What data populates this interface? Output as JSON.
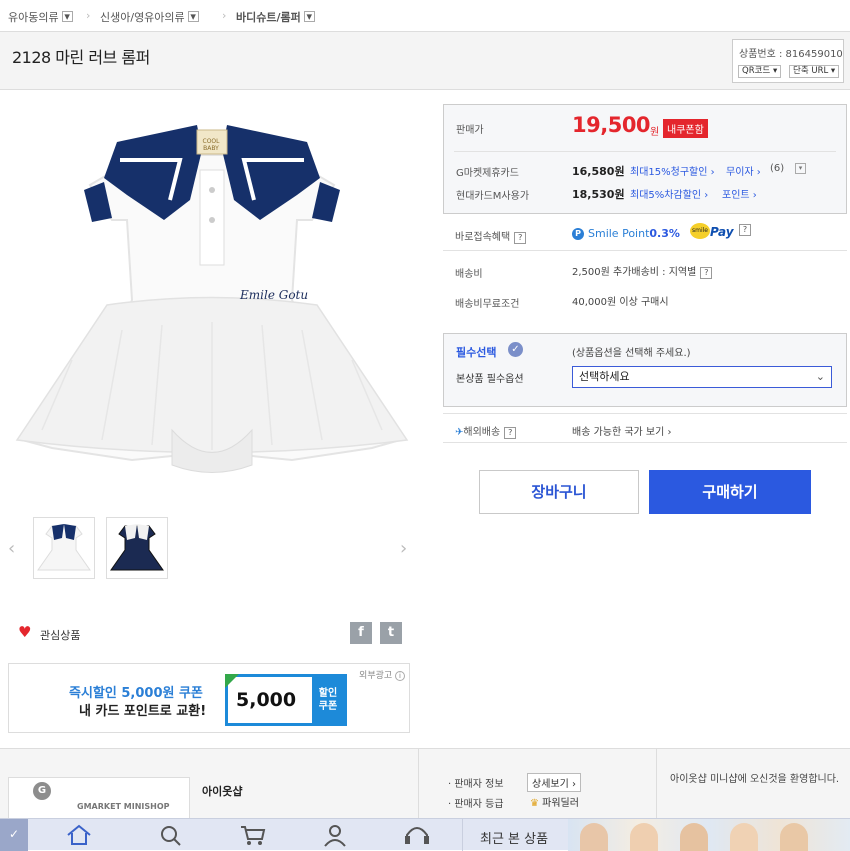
{
  "breadcrumb": {
    "level1": "유아동의류",
    "level2": "신생아/영유아의류",
    "level3": "바디슈트/롬퍼"
  },
  "product": {
    "title": "2128 마린 러브 롬퍼",
    "number_label": "상품번호 : 816459010",
    "qr_button": "QR코드",
    "short_url_button": "단축 URL"
  },
  "images": {
    "collar_tag": "COOL BABY",
    "embroidery": "Emile Gotu",
    "thumbs": [
      "white-romper",
      "navy-romper"
    ]
  },
  "price": {
    "label": "판매가",
    "value": "19,500",
    "unit": "원",
    "coupon_badge": "내쿠폰함",
    "card1_label": "G마켓제휴카드",
    "card1_price": "16,580원",
    "card1_discount": "최대15%청구할인",
    "card1_extra": "무이자",
    "card1_count": "(6)",
    "card2_label": "현대카드M사용가",
    "card2_price": "18,530원",
    "card2_discount": "최대5%차감할인",
    "card2_extra": "포인트"
  },
  "benefit": {
    "label": "바로접속혜택",
    "smile_point": "Smile Point",
    "rate": "0.3%",
    "smile_logo": "smile",
    "pay": "Pay"
  },
  "shipping": {
    "fee_label": "배송비",
    "fee_value": "2,500원 추가배송비 : 지역별",
    "free_label": "배송비무료조건",
    "free_value": "40,000원 이상 구매시"
  },
  "options": {
    "required_label": "필수선택",
    "hint": "(상품옵션을 선택해 주세요.)",
    "option_label": "본상품 필수옵션",
    "select_value": "선택하세요"
  },
  "overseas": {
    "label": "해외배송",
    "value": "배송 가능한 국가 보기"
  },
  "buttons": {
    "cart": "장바구니",
    "buy": "구매하기"
  },
  "wishlist": {
    "label": "관심상품"
  },
  "ad": {
    "tag": "외부광고",
    "line1": "즉시할인 5,000원 쿠폰",
    "line2": "내 카드 포인트로 교환!",
    "coupon_value": "5,000",
    "coupon_text1": "할인",
    "coupon_text2": "쿠폰"
  },
  "seller": {
    "minishop_label": "GMARKET MINISHOP",
    "shop_name": "아이옷샵",
    "info_label": "판매자 정보",
    "detail_button": "상세보기",
    "grade_label": "판매자 등급",
    "grade_value": "파워딜러",
    "welcome": "아이옷샵 미니샵에 오신것을 환영합니다."
  },
  "bottom_nav": {
    "recent_label": "최근 본 상품"
  },
  "colors": {
    "price_red": "#e4262d",
    "accent_blue": "#2b59e0",
    "navy": "#16306a"
  }
}
